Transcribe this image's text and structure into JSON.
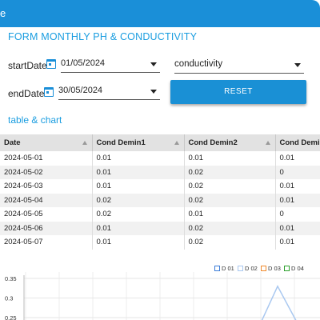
{
  "window": {
    "title_fragment": "e"
  },
  "form": {
    "title": "FORM MONTHLY PH & CONDUCTIVITY",
    "start_label": "startDate",
    "start_value": "01/05/2024",
    "end_label": "endDate",
    "end_value": "30/05/2024",
    "metric_value": "conductivity",
    "reset_label": "RESET"
  },
  "section": {
    "title": "table & chart"
  },
  "table": {
    "columns": [
      "Date",
      "Cond Demin1",
      "Cond Demin2",
      "Cond Demi"
    ],
    "rows": [
      [
        "2024-05-01",
        "0.01",
        "0.01",
        "0.01"
      ],
      [
        "2024-05-02",
        "0.01",
        "0.02",
        "0"
      ],
      [
        "2024-05-03",
        "0.01",
        "0.02",
        "0.01"
      ],
      [
        "2024-05-04",
        "0.02",
        "0.02",
        "0.01"
      ],
      [
        "2024-05-05",
        "0.02",
        "0.01",
        "0"
      ],
      [
        "2024-05-06",
        "0.01",
        "0.02",
        "0.01"
      ],
      [
        "2024-05-07",
        "0.01",
        "0.02",
        "0.01"
      ]
    ]
  },
  "chart_data": {
    "type": "line",
    "ylim": [
      0.25,
      0.35
    ],
    "yticks": [
      "0.35",
      "0.3",
      "0.25"
    ],
    "legend_position": "top-right",
    "series": [
      {
        "name": "D 01",
        "color": "#3b7dd8"
      },
      {
        "name": "D 02",
        "color": "#a9c8f0"
      },
      {
        "name": "D 03",
        "color": "#f08a2c"
      },
      {
        "name": "D 04",
        "color": "#2ca02c"
      }
    ],
    "d02_peak": {
      "day_index": 17,
      "value": 0.33
    }
  }
}
